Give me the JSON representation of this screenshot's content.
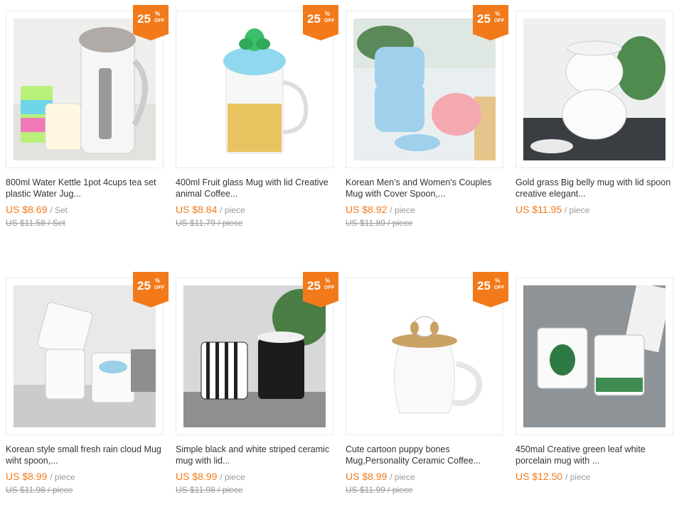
{
  "products": [
    {
      "title": "800ml Water Kettle 1pot 4cups tea set plastic Water Jug...",
      "price": "US $8.69",
      "unit": "/ Set",
      "original": "US $11.58 / Set",
      "discount": {
        "value": "25",
        "percent": "%",
        "off": "OFF"
      }
    },
    {
      "title": "400ml Fruit glass Mug with lid Creative animal Coffee...",
      "price": "US $8.84",
      "unit": "/ piece",
      "original": "US $11.79 / piece",
      "discount": {
        "value": "25",
        "percent": "%",
        "off": "OFF"
      }
    },
    {
      "title": "Korean Men's and Women's Couples Mug with Cover Spoon,...",
      "price": "US $8.92",
      "unit": "/ piece",
      "original": "US $11.89 / piece",
      "discount": {
        "value": "25",
        "percent": "%",
        "off": "OFF"
      }
    },
    {
      "title": "Gold grass Big belly mug with lid spoon creative elegant...",
      "price": "US $11.95",
      "unit": "/ piece",
      "original": "",
      "discount": null
    },
    {
      "title": "Korean style small fresh rain cloud Mug wiht spoon,...",
      "price": "US $8.99",
      "unit": "/ piece",
      "original": "US $11.98 / piece",
      "discount": {
        "value": "25",
        "percent": "%",
        "off": "OFF"
      }
    },
    {
      "title": "Simple black and white striped ceramic mug with lid...",
      "price": "US $8.99",
      "unit": "/ piece",
      "original": "US $11.98 / piece",
      "discount": {
        "value": "25",
        "percent": "%",
        "off": "OFF"
      }
    },
    {
      "title": "Cute cartoon puppy bones Mug,Personality Ceramic Coffee...",
      "price": "US $8.99",
      "unit": "/ piece",
      "original": "US $11.99 / piece",
      "discount": {
        "value": "25",
        "percent": "%",
        "off": "OFF"
      }
    },
    {
      "title": "450mal Creative green leaf white porcelain mug with ...",
      "price": "US $12.50",
      "unit": "/ piece",
      "original": "",
      "discount": null
    }
  ],
  "colors": {
    "accent": "#f27a1a",
    "muted": "#999999",
    "text": "#333333"
  }
}
